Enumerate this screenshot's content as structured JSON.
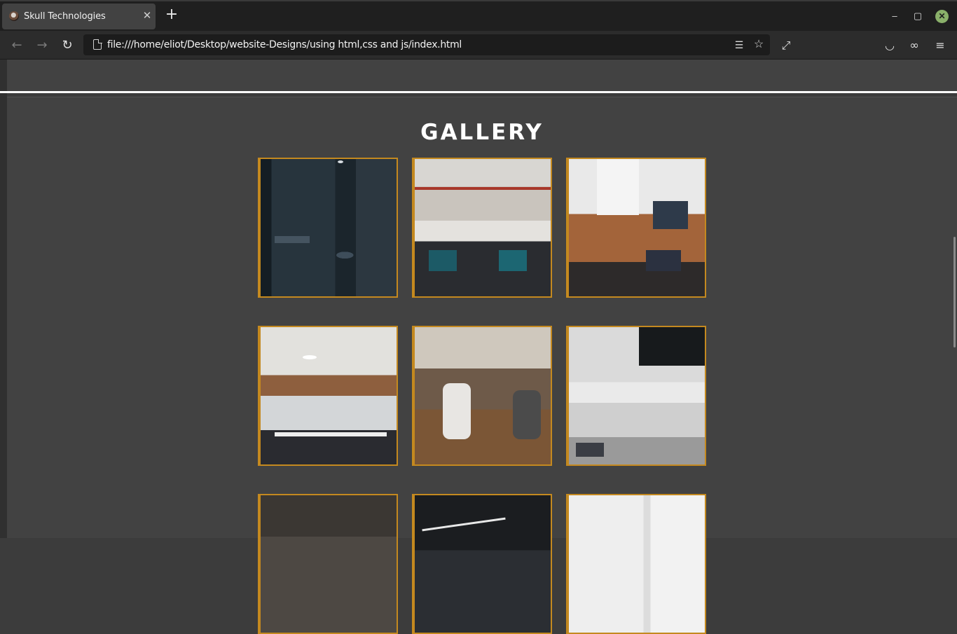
{
  "browser": {
    "tab_title": "Skull Technologies",
    "tab_close": "✕",
    "new_tab": "+",
    "url": "file:///home/eliot/Desktop/website-Designs/using html,css and js/index.html",
    "window_min": "–",
    "window_max": "▢",
    "window_close": "✕"
  },
  "nav": {
    "back": "←",
    "forward": "→",
    "reload": "↻",
    "reader": "☰",
    "star": "☆",
    "fullscreen": "⤢",
    "pocket": "◡",
    "private": "∞",
    "menu": "≡"
  },
  "gallery": {
    "title": "GALLERY",
    "photos": [
      "dark-office-meeting",
      "open-office-pendant-lights",
      "conference-table-laptops",
      "office-interior-chairs",
      "team-meeting-table",
      "open-office-desks",
      "office-ceiling-beams",
      "office-ceiling-lights",
      "white-office-window"
    ]
  },
  "colors": {
    "tile_border": "#c4891f",
    "page_background": "#424242",
    "divider": "#ffffff"
  }
}
